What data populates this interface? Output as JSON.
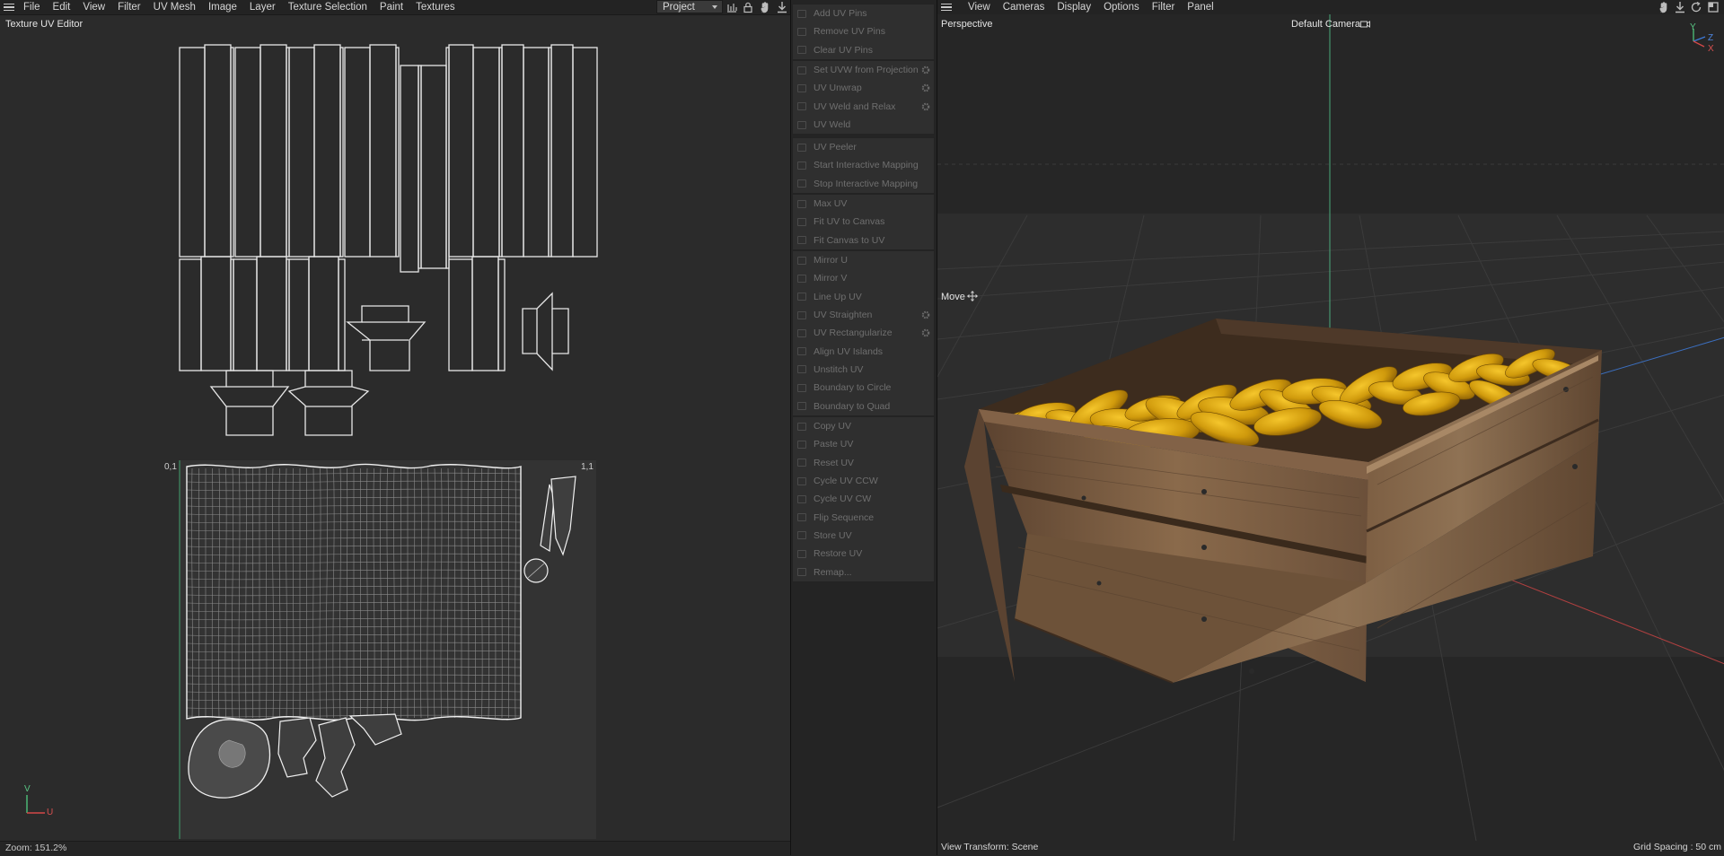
{
  "uv_editor": {
    "menu": [
      "File",
      "Edit",
      "View",
      "Filter",
      "UV Mesh",
      "Image",
      "Layer",
      "Texture Selection",
      "Paint",
      "Textures"
    ],
    "project_dropdown": "Project",
    "title": "Texture UV Editor",
    "corner_top_left": "0,1",
    "corner_top_right": "1,1",
    "axis_v": "V",
    "axis_u": "U",
    "zoom": "Zoom: 151.2%",
    "toolbar_icons": [
      "chart-icon",
      "lock-icon",
      "hand-icon",
      "download-icon"
    ]
  },
  "uv_commands": {
    "groups": [
      [
        {
          "label": "Add UV Pins"
        },
        {
          "label": "Remove UV Pins"
        },
        {
          "label": "Clear UV Pins"
        }
      ],
      [
        {
          "label": "Set UVW from Projection",
          "gear": true
        },
        {
          "label": "UV Unwrap",
          "gear": true
        },
        {
          "label": "UV Weld and Relax",
          "gear": true
        },
        {
          "label": "UV Weld"
        }
      ],
      [
        {
          "label": "UV Peeler"
        },
        {
          "label": "Start Interactive Mapping"
        },
        {
          "label": "Stop Interactive Mapping"
        }
      ],
      [
        {
          "label": "Max UV"
        },
        {
          "label": "Fit UV to Canvas"
        },
        {
          "label": "Fit Canvas to UV"
        }
      ],
      [
        {
          "label": "Mirror U"
        },
        {
          "label": "Mirror V"
        },
        {
          "label": "Line Up UV"
        },
        {
          "label": "UV Straighten",
          "gear": true
        },
        {
          "label": "UV Rectangularize",
          "gear": true
        },
        {
          "label": "Align UV Islands"
        },
        {
          "label": "Unstitch UV"
        },
        {
          "label": "Boundary to Circle"
        },
        {
          "label": "Boundary to Quad"
        }
      ],
      [
        {
          "label": "Copy UV"
        },
        {
          "label": "Paste UV"
        },
        {
          "label": "Reset UV"
        },
        {
          "label": "Cycle UV CCW"
        },
        {
          "label": "Cycle UV CW"
        },
        {
          "label": "Flip Sequence"
        },
        {
          "label": "Store UV"
        },
        {
          "label": "Restore UV"
        },
        {
          "label": "Remap..."
        }
      ]
    ]
  },
  "viewport": {
    "menu": [
      "View",
      "Cameras",
      "Display",
      "Options",
      "Filter",
      "Panel"
    ],
    "view_name": "Perspective",
    "camera": "Default Camera",
    "tool_label": "Move",
    "view_transform": "View Transform: Scene",
    "grid_spacing": "Grid Spacing : 50 cm",
    "axis_labels": [
      "Y",
      "Z",
      "X"
    ],
    "toolbar_icons": [
      "hand-icon",
      "download-icon",
      "rotate-icon",
      "maximize-icon"
    ]
  },
  "colors": {
    "uv_wire": "#e8e8e8",
    "crate_wood": "#7a5a3c",
    "fruit": "#d4a30a",
    "grid_green": "#58c08a",
    "axis_red": "#c84040",
    "axis_blue": "#3c7ad8"
  }
}
